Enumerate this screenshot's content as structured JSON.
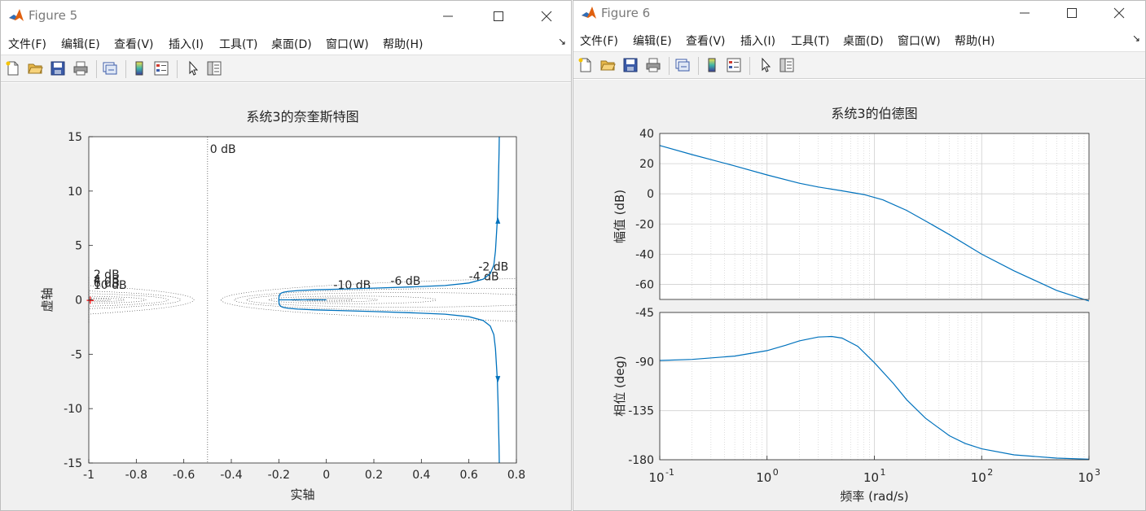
{
  "figure5": {
    "title": "Figure 5",
    "menu": [
      "文件(F)",
      "编辑(E)",
      "查看(V)",
      "插入(I)",
      "工具(T)",
      "桌面(D)",
      "窗口(W)",
      "帮助(H)"
    ],
    "toolbar_icons": [
      "new-file-icon",
      "open-folder-icon",
      "save-icon",
      "print-icon",
      "link-figure-icon",
      "insert-colorbar-icon",
      "insert-legend-icon",
      "pointer-icon",
      "property-inspector-icon"
    ]
  },
  "figure6": {
    "title": "Figure 6",
    "menu": [
      "文件(F)",
      "编辑(E)",
      "查看(V)",
      "插入(I)",
      "工具(T)",
      "桌面(D)",
      "窗口(W)",
      "帮助(H)"
    ],
    "toolbar_icons": [
      "new-file-icon",
      "open-folder-icon",
      "save-icon",
      "print-icon",
      "link-figure-icon",
      "insert-colorbar-icon",
      "insert-legend-icon",
      "pointer-icon",
      "property-inspector-icon"
    ]
  },
  "colors": {
    "line": "#0072bd",
    "grid": "#d9d9d9",
    "axes": "#262626",
    "critical_point": "#ff0000"
  },
  "chart_data": [
    {
      "type": "line",
      "title": "系统3的奈奎斯特图",
      "xlabel": "实轴",
      "ylabel": "虚轴",
      "xlim": [
        -1,
        0.8
      ],
      "ylim": [
        -15,
        15
      ],
      "xticks": [
        -1,
        -0.8,
        -0.6,
        -0.4,
        -0.2,
        0,
        0.2,
        0.4,
        0.6,
        0.8
      ],
      "yticks": [
        -15,
        -10,
        -5,
        0,
        5,
        10,
        15
      ],
      "xtick_labels": [
        "-1",
        "-0.8",
        "-0.6",
        "-0.4",
        "-0.2",
        "0",
        "0.2",
        "0.4",
        "0.6",
        "0.8"
      ],
      "ytick_labels": [
        "-15",
        "-10",
        "-5",
        "0",
        "5",
        "10",
        "15"
      ],
      "grid": "M-circles (dotted)",
      "m_circle_labels": [
        {
          "text": "0 dB",
          "x": -0.49,
          "y": 13.5
        },
        {
          "text": "2 dB",
          "x": -0.98,
          "y": 2.0
        },
        {
          "text": "4 dB",
          "x": -0.98,
          "y": 1.5
        },
        {
          "text": "6 dB",
          "x": -0.98,
          "y": 1.2
        },
        {
          "text": "10 dB",
          "x": -0.98,
          "y": 1.0
        },
        {
          "text": "-10 dB",
          "x": 0.03,
          "y": 1.0
        },
        {
          "text": "-6 dB",
          "x": 0.27,
          "y": 1.4
        },
        {
          "text": "-4 dB",
          "x": 0.6,
          "y": 1.8
        },
        {
          "text": "-2 dB",
          "x": 0.64,
          "y": 2.7
        }
      ],
      "series": [
        {
          "x": [
            -0.2,
            -0.199,
            -0.196,
            -0.19,
            -0.18,
            -0.16,
            -0.12,
            -0.05,
            0.05,
            0.2,
            0.35,
            0.5,
            0.6,
            0.66,
            0.69,
            0.705,
            0.712,
            0.716,
            0.72,
            0.723,
            0.725,
            0.727,
            0.728
          ],
          "y": [
            0,
            0.3,
            0.5,
            0.62,
            0.7,
            0.78,
            0.85,
            0.92,
            0.98,
            1.08,
            1.18,
            1.32,
            1.55,
            1.9,
            2.4,
            3.2,
            4.5,
            6.0,
            7.5,
            9.5,
            11.5,
            13.5,
            15
          ]
        },
        {
          "x": [
            -0.2,
            -0.199,
            -0.196,
            -0.19,
            -0.18,
            -0.16,
            -0.12,
            -0.05,
            0.05,
            0.2,
            0.35,
            0.5,
            0.6,
            0.66,
            0.69,
            0.705,
            0.712,
            0.716,
            0.72,
            0.723,
            0.725,
            0.727,
            0.728
          ],
          "y": [
            0,
            -0.3,
            -0.5,
            -0.62,
            -0.7,
            -0.78,
            -0.85,
            -0.92,
            -0.98,
            -1.08,
            -1.18,
            -1.32,
            -1.55,
            -1.9,
            -2.4,
            -3.2,
            -4.5,
            -6.0,
            -7.5,
            -9.5,
            -11.5,
            -13.5,
            -15
          ]
        },
        {
          "x": [
            -0.2,
            -0.1,
            0.0
          ],
          "y": [
            0,
            0,
            0
          ]
        }
      ],
      "arrows": [
        {
          "x": 0.722,
          "y": 7.3,
          "dir": "up"
        },
        {
          "x": 0.722,
          "y": -7.3,
          "dir": "down"
        }
      ],
      "critical_point": {
        "x": -1,
        "y": 0
      }
    },
    {
      "type": "line",
      "title": "系统3的伯德图",
      "xlabel": "频率  (rad/s)",
      "xscale": "log",
      "xlim": [
        0.1,
        1000
      ],
      "xtick_labels": [
        "10",
        "10",
        "10",
        "10",
        "10"
      ],
      "xtick_exponents": [
        "-1",
        "0",
        "1",
        "2",
        "3"
      ],
      "xtick_values": [
        0.1,
        1,
        10,
        100,
        1000
      ],
      "grid": true,
      "panels": [
        {
          "ylabel": "幅值 (dB)",
          "ylim": [
            -70,
            40
          ],
          "yticks": [
            -60,
            -40,
            -20,
            0,
            20,
            40
          ],
          "ytick_labels": [
            "-60",
            "-40",
            "-20",
            "0",
            "20",
            "40"
          ],
          "x": [
            0.1,
            0.2,
            0.5,
            1,
            2,
            3,
            5,
            8,
            12,
            20,
            30,
            50,
            100,
            200,
            500,
            1000
          ],
          "y": [
            32,
            26,
            18.5,
            12.5,
            7,
            4.5,
            2,
            -0.5,
            -4,
            -11,
            -18,
            -27,
            -40,
            -51,
            -64,
            -71
          ]
        },
        {
          "ylabel": "相位 (deg)",
          "ylim": [
            -180,
            -45
          ],
          "yticks": [
            -180,
            -135,
            -90,
            -45
          ],
          "ytick_labels": [
            "-180",
            "-135",
            "-90",
            "-45"
          ],
          "x": [
            0.1,
            0.2,
            0.5,
            1,
            1.5,
            2,
            3,
            4,
            5,
            7,
            10,
            15,
            20,
            30,
            50,
            70,
            100,
            200,
            500,
            1000
          ],
          "y": [
            -89,
            -88,
            -85,
            -80,
            -75,
            -71,
            -67.5,
            -67,
            -68.5,
            -76,
            -91,
            -110,
            -125,
            -142,
            -158,
            -165,
            -170,
            -175.5,
            -178.5,
            -179.5
          ]
        }
      ]
    }
  ]
}
